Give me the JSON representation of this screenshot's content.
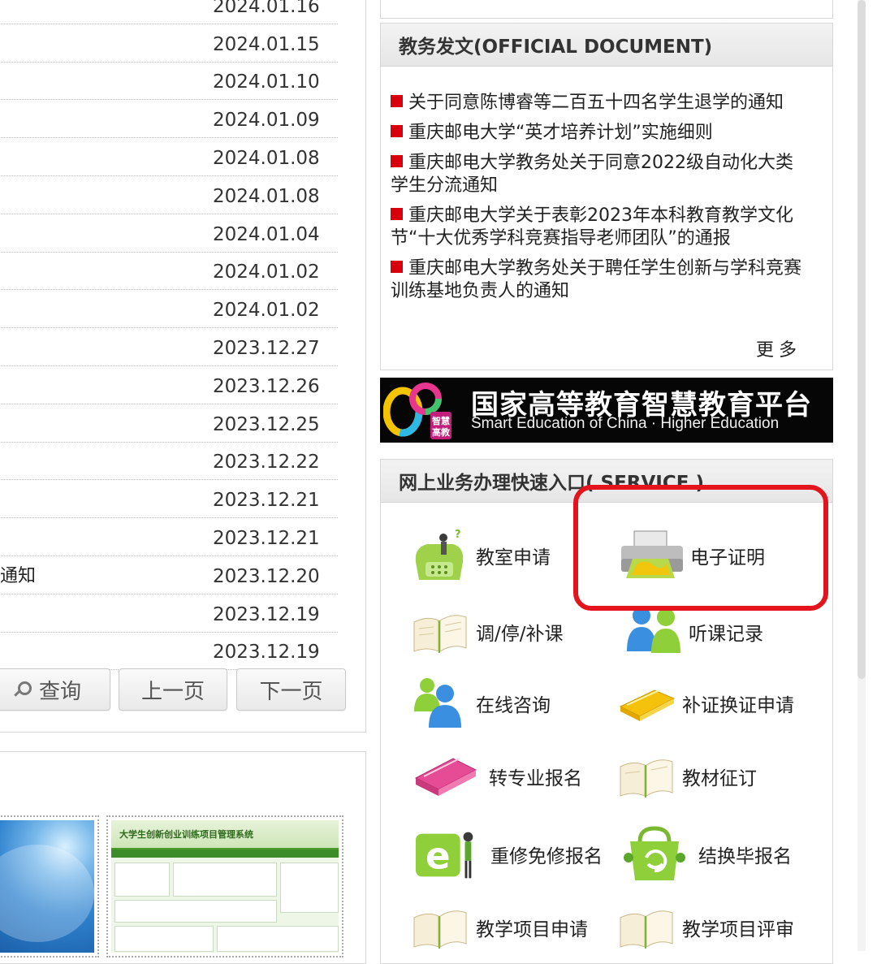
{
  "news_list": [
    {
      "title": "",
      "date": "2024.01.16"
    },
    {
      "title": "",
      "date": "2024.01.15"
    },
    {
      "title": "",
      "date": "2024.01.10"
    },
    {
      "title": "",
      "date": "2024.01.09"
    },
    {
      "title": "",
      "date": "2024.01.08"
    },
    {
      "title": "",
      "date": "2024.01.08"
    },
    {
      "title": "",
      "date": "2024.01.04"
    },
    {
      "title": "",
      "date": "2024.01.02"
    },
    {
      "title": "",
      "date": "2024.01.02"
    },
    {
      "title": "",
      "date": "2023.12.27"
    },
    {
      "title": "",
      "date": "2023.12.26"
    },
    {
      "title": "",
      "date": "2023.12.25"
    },
    {
      "title": "",
      "date": "2023.12.22"
    },
    {
      "title": "",
      "date": "2023.12.21"
    },
    {
      "title": "",
      "date": "2023.12.21"
    },
    {
      "title": "通知",
      "date": "2023.12.20"
    },
    {
      "title": "",
      "date": "2023.12.19"
    },
    {
      "title": "",
      "date": "2023.12.19"
    }
  ],
  "pager": {
    "search": "查询",
    "prev": "上一页",
    "next": "下一页"
  },
  "thumb_site_title": "大学生创新创业训练项目管理系统",
  "official_documents": {
    "title": "教务发文(OFFICIAL DOCUMENT)",
    "items": [
      "关于同意陈博睿等二百五十四名学生退学的通知",
      "重庆邮电大学“英才培养计划”实施细则",
      "重庆邮电大学教务处关于同意2022级自动化大类学生分流通知",
      "重庆邮电大学关于表彰2023年本科教育教学文化节“十大优秀学科竞赛指导老师团队”的通报",
      "重庆邮电大学教务处关于聘任学生创新与学科竞赛训练基地负责人的通知"
    ],
    "more": "更多"
  },
  "banner": {
    "title": "国家高等教育智慧教育平台",
    "subtitle": "Smart Education of China · Higher Education",
    "logo_text": "智慧高教"
  },
  "services": {
    "title": "网上业务办理快速入口( SERVICE )",
    "items": [
      {
        "label": "教室申请",
        "icon": "phone-person-icon"
      },
      {
        "label": "电子证明",
        "icon": "printer-icon"
      },
      {
        "label": "调/停/补课",
        "icon": "book-icon"
      },
      {
        "label": "听课记录",
        "icon": "people-icon"
      },
      {
        "label": "在线咨询",
        "icon": "chat-people-icon"
      },
      {
        "label": "补证换证申请",
        "icon": "yellow-notebook-icon"
      },
      {
        "label": "转专业报名",
        "icon": "pink-notebook-icon"
      },
      {
        "label": "教材征订",
        "icon": "book-icon"
      },
      {
        "label": "重修免修报名",
        "icon": "e-person-icon"
      },
      {
        "label": "结换毕报名",
        "icon": "recycle-bag-icon"
      },
      {
        "label": "教学项目申请",
        "icon": "book-icon"
      },
      {
        "label": "教学项目评审",
        "icon": "book-icon"
      }
    ]
  },
  "colors": {
    "accent_red": "#d9000d",
    "highlight_red": "#e4141c",
    "banner_bg": "#060606"
  }
}
